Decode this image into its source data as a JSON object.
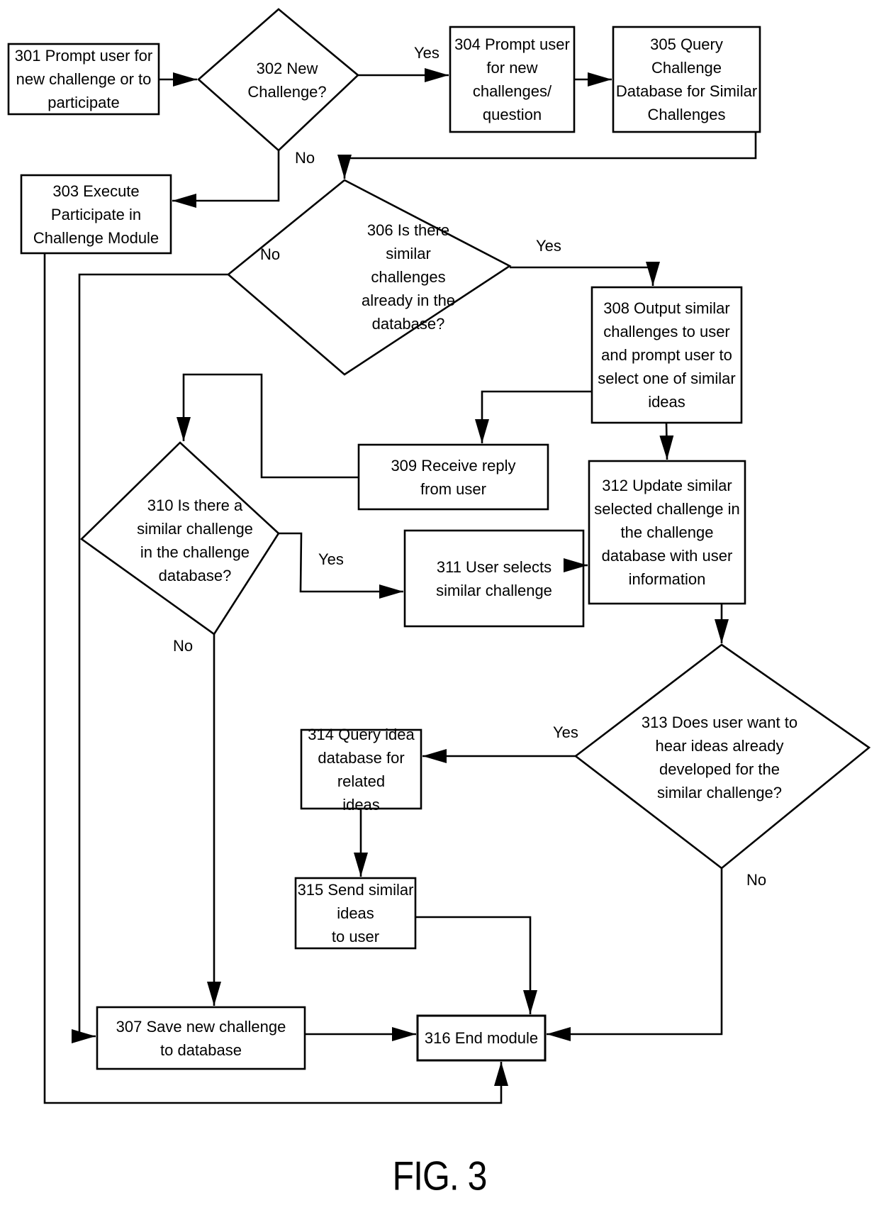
{
  "figure": {
    "caption": "FIG. 3",
    "type": "flowchart"
  },
  "nodes": {
    "n301": {
      "id": "301",
      "shape": "process",
      "text": "301 Prompt user for\nnew challenge or to\nparticipate"
    },
    "n302": {
      "id": "302",
      "shape": "decision",
      "text": "302 New\nChallenge?"
    },
    "n303": {
      "id": "303",
      "shape": "process",
      "text": "303 Execute\nParticipate in\nChallenge Module"
    },
    "n304": {
      "id": "304",
      "shape": "process",
      "text": "304 Prompt user\nfor new\nchallenges/\nquestion"
    },
    "n305": {
      "id": "305",
      "shape": "process",
      "text": "305 Query Challenge\nDatabase for Similar\nChallenges"
    },
    "n306": {
      "id": "306",
      "shape": "decision",
      "text": "306 Is there\nsimilar\nchallenges\nalready in the\ndatabase?"
    },
    "n307": {
      "id": "307",
      "shape": "process",
      "text": "307 Save new challenge\nto database"
    },
    "n308": {
      "id": "308",
      "shape": "process",
      "text": "308 Output similar\nchallenges to user\nand prompt user to\nselect one of similar\nideas"
    },
    "n309": {
      "id": "309",
      "shape": "process",
      "text": "309 Receive reply\nfrom user"
    },
    "n310": {
      "id": "310",
      "shape": "decision",
      "text": "310 Is there a\nsimilar challenge\nin the challenge\ndatabase?"
    },
    "n311": {
      "id": "311",
      "shape": "process",
      "text": "311 User selects\nsimilar challenge"
    },
    "n312": {
      "id": "312",
      "shape": "process",
      "text": "312 Update similar\nselected challenge in\nthe challenge\ndatabase with user\ninformation"
    },
    "n313": {
      "id": "313",
      "shape": "decision",
      "text": "313 Does user  want to\nhear ideas already\ndeveloped for the\nsimilar challenge?"
    },
    "n314": {
      "id": "314",
      "shape": "process",
      "text": "314 Query idea\ndatabase for related\nideas"
    },
    "n315": {
      "id": "315",
      "shape": "process",
      "text": "315 Send similar ideas\nto user"
    },
    "n316": {
      "id": "316",
      "shape": "terminal",
      "text": "316 End module"
    }
  },
  "edges": [
    {
      "from": "301",
      "to": "302",
      "label": ""
    },
    {
      "from": "302",
      "to": "304",
      "label": "Yes"
    },
    {
      "from": "302",
      "to": "303",
      "label": "No"
    },
    {
      "from": "304",
      "to": "305",
      "label": ""
    },
    {
      "from": "305",
      "to": "306",
      "label": ""
    },
    {
      "from": "306",
      "to": "308",
      "label": "Yes"
    },
    {
      "from": "306",
      "to": "307",
      "label": "No"
    },
    {
      "from": "308",
      "to": "309",
      "label": ""
    },
    {
      "from": "308",
      "to": "312",
      "label": ""
    },
    {
      "from": "309",
      "to": "310",
      "label": ""
    },
    {
      "from": "310",
      "to": "311",
      "label": "Yes"
    },
    {
      "from": "310",
      "to": "307",
      "label": "No"
    },
    {
      "from": "311",
      "to": "312",
      "label": ""
    },
    {
      "from": "312",
      "to": "313",
      "label": ""
    },
    {
      "from": "313",
      "to": "314",
      "label": "Yes"
    },
    {
      "from": "313",
      "to": "316",
      "label": "No"
    },
    {
      "from": "314",
      "to": "315",
      "label": ""
    },
    {
      "from": "315",
      "to": "316",
      "label": ""
    },
    {
      "from": "307",
      "to": "316",
      "label": ""
    },
    {
      "from": "303",
      "to": "316",
      "label": ""
    }
  ],
  "labels": {
    "yes_302": "Yes",
    "no_302": "No",
    "yes_306": "Yes",
    "no_306": "No",
    "yes_310": "Yes",
    "no_310": "No",
    "yes_313": "Yes",
    "no_313": "No"
  },
  "colors": {
    "stroke": "#000000",
    "background": "#ffffff"
  }
}
